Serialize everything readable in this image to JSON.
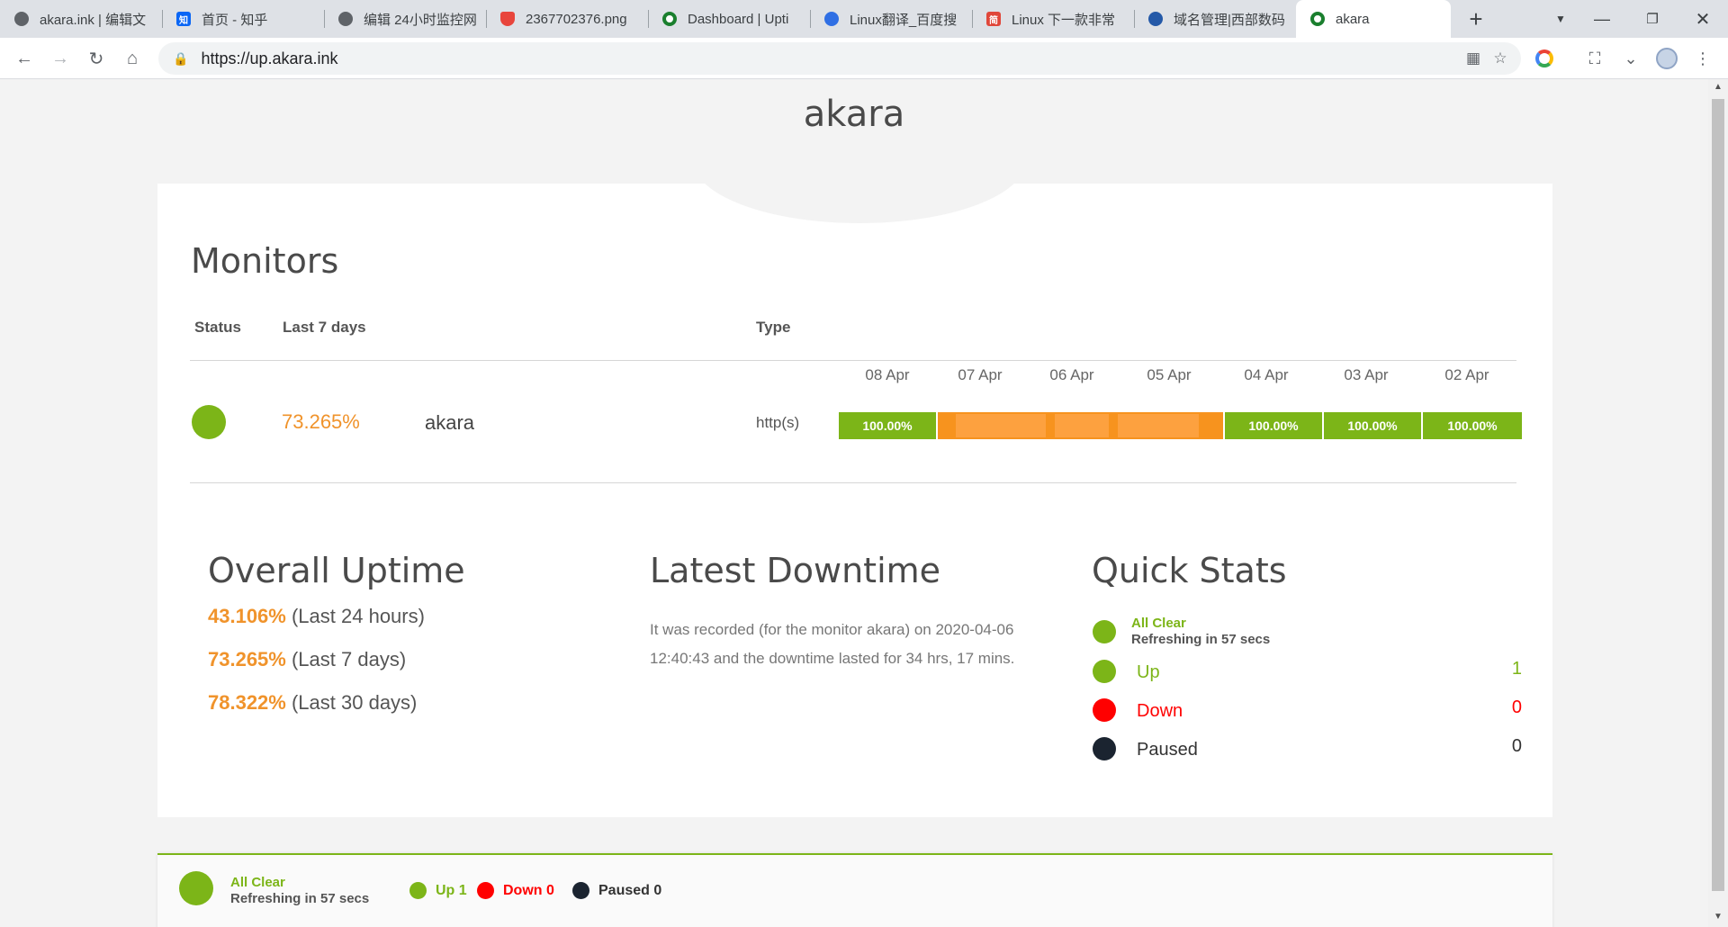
{
  "browser": {
    "tabs": [
      {
        "label": "akara.ink | 编辑文",
        "icon": "globe-icon"
      },
      {
        "label": "首页 - 知乎",
        "icon": "zhihu-icon"
      },
      {
        "label": "编辑 24小时监控网",
        "icon": "globe-icon"
      },
      {
        "label": "2367702376.png",
        "icon": "shield-icon"
      },
      {
        "label": "Dashboard | Upti",
        "icon": "uptime-icon"
      },
      {
        "label": "Linux翻译_百度搜",
        "icon": "baidu-paw-icon"
      },
      {
        "label": "Linux 下一款非常",
        "icon": "jianshu-icon"
      },
      {
        "label": "域名管理|西部数码",
        "icon": "west-icon"
      },
      {
        "label": "akara",
        "icon": "uptime-icon"
      }
    ],
    "new_tab": "+",
    "url": "https://up.akara.ink"
  },
  "page": {
    "site_title": "akara",
    "monitors_title": "Monitors",
    "columns": {
      "status": "Status",
      "last7": "Last 7 days",
      "type": "Type"
    },
    "days": [
      "08 Apr",
      "07 Apr",
      "06 Apr",
      "05 Apr",
      "04 Apr",
      "03 Apr",
      "02 Apr"
    ],
    "monitor": {
      "name": "akara",
      "uptime_7d": "73.265%",
      "type": "http(s)",
      "day_values": [
        "100.00%",
        "",
        "",
        "",
        "100.00%",
        "100.00%",
        "100.00%"
      ]
    },
    "overall": {
      "title": "Overall Uptime",
      "rows": [
        {
          "pct": "43.106%",
          "label": "(Last 24 hours)"
        },
        {
          "pct": "73.265%",
          "label": "(Last 7 days)"
        },
        {
          "pct": "78.322%",
          "label": "(Last 30 days)"
        }
      ]
    },
    "downtime": {
      "title": "Latest Downtime",
      "text": "It was recorded (for the monitor akara) on 2020-04-06 12:40:43 and the downtime lasted for 34 hrs, 17 mins."
    },
    "quick_stats": {
      "title": "Quick Stats",
      "all_clear": "All Clear",
      "refresh": "Refreshing in 57 secs",
      "up_label": "Up",
      "up_count": "1",
      "down_label": "Down",
      "down_count": "0",
      "paused_label": "Paused",
      "paused_count": "0"
    },
    "footer": {
      "all_clear": "All Clear",
      "refresh": "Refreshing in 57 secs",
      "up": "Up 1",
      "down": "Down 0",
      "paused": "Paused 0"
    },
    "colors": {
      "up": "#7cb518",
      "down": "#ff0000",
      "paused": "#1b2430",
      "accent": "#f0932b"
    }
  }
}
